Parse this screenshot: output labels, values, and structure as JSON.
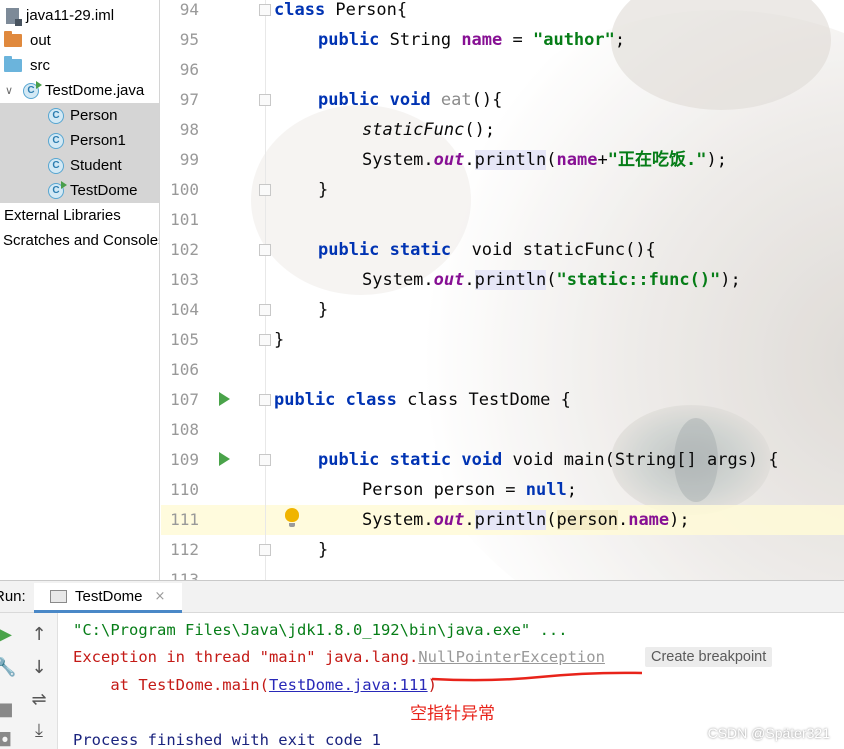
{
  "project_tree": {
    "items": [
      {
        "label": "java11-29.iml",
        "icon": "module-file-icon"
      },
      {
        "label": "out",
        "icon": "folder-icon"
      },
      {
        "label": "src",
        "icon": "folder-icon"
      },
      {
        "label": "TestDome.java",
        "icon": "java-class-icon"
      },
      {
        "label": "Person",
        "icon": "class-icon"
      },
      {
        "label": "Person1",
        "icon": "class-icon"
      },
      {
        "label": "Student",
        "icon": "class-icon"
      },
      {
        "label": "TestDome",
        "icon": "runnable-class-icon"
      },
      {
        "label": "External Libraries",
        "icon": ""
      },
      {
        "label": "Scratches and Consoles",
        "icon": ""
      }
    ],
    "colors": {
      "out_folder": "#e0893d",
      "src_folder": "#6bb4dc",
      "selection": "#d5d5d5"
    }
  },
  "editor": {
    "line_numbers": [
      "94",
      "95",
      "96",
      "97",
      "98",
      "99",
      "100",
      "101",
      "102",
      "103",
      "104",
      "105",
      "106",
      "107",
      "108",
      "109",
      "110",
      "111",
      "112",
      "113"
    ],
    "tokens": {
      "class": "class",
      "public": "public",
      "static": "static",
      "void": "void",
      "null": "null",
      "person_cls_name": " Person{",
      "field_type": " String ",
      "field_name": "name",
      "eq": " = ",
      "author_str": "\"author\"",
      "semicolon": ";",
      "eat_name": "eat",
      "eat_sig": "(){",
      "static_func_call": "staticFunc",
      "call_end": "();",
      "system_dot": "System.",
      "out": "out",
      "println": "println",
      "dot": ".",
      "paren_open": "(",
      "plus": "+",
      "eating_str": "\"正在吃饭.\"",
      "close_semi": ");",
      "brace_close": "}",
      "static_func_decl": "  void staticFunc(){",
      "static_func_str": "\"static::func()\"",
      "testdome_decl": " class TestDome {",
      "main_sig": " void main(String[] args) {",
      "person_decl": "Person person = ",
      "person_ref": "person",
      "name_ref": "name"
    },
    "current_line": "111"
  },
  "run_panel": {
    "label": "Run:",
    "tab_title": "TestDome",
    "close_glyph": "×",
    "console": {
      "command": "\"C:\\Program Files\\Java\\jdk1.8.0_192\\bin\\java.exe\" ...",
      "exception_prefix": "Exception in thread \"main\" java.lang.",
      "exception_class": "NullPointerException",
      "create_breakpoint": "Create breakpoint",
      "stack_prefix": "    at TestDome.main(",
      "stack_link": "TestDome.java:111",
      "stack_suffix": ")",
      "finished": "Process finished with exit code 1"
    },
    "annotation": "空指针异常"
  },
  "watermark": "CSDN @Später321"
}
